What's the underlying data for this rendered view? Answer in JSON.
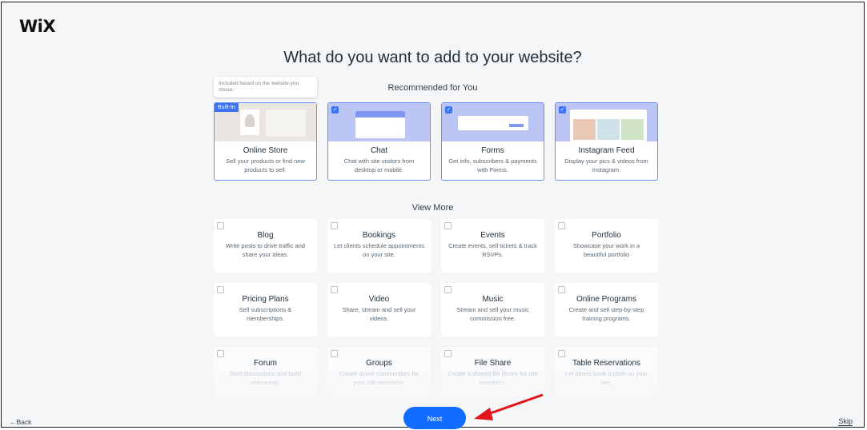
{
  "app": {
    "logo": "WiX"
  },
  "page": {
    "title": "What do you want to add to your website?"
  },
  "tooltip": {
    "text": "Included based on the website you chose."
  },
  "recommended": {
    "label": "Recommended for You",
    "cards": [
      {
        "badge": "Built-In",
        "name": "Online Store",
        "desc": "Sell your products or find new products to sell.",
        "checked": true
      },
      {
        "name": "Chat",
        "desc": "Chat with site visitors from desktop or mobile.",
        "checked": true
      },
      {
        "name": "Forms",
        "desc": "Get info, subscribers & payments with Forms.",
        "checked": true
      },
      {
        "name": "Instagram Feed",
        "desc": "Display your pics & videos from Instagram.",
        "checked": true
      }
    ]
  },
  "more": {
    "label": "View More",
    "cards": [
      {
        "name": "Blog",
        "desc": "Write posts to drive traffic and share your ideas."
      },
      {
        "name": "Bookings",
        "desc": "Let clients schedule appointments on your site."
      },
      {
        "name": "Events",
        "desc": "Create events, sell tickets & track RSVPs."
      },
      {
        "name": "Portfolio",
        "desc": "Showcase your work in a beautiful portfolio"
      },
      {
        "name": "Pricing Plans",
        "desc": "Sell subscriptions & memberships."
      },
      {
        "name": "Video",
        "desc": "Share, stream and sell your videos."
      },
      {
        "name": "Music",
        "desc": "Stream and sell your music commission free."
      },
      {
        "name": "Online Programs",
        "desc": "Create and sell step-by-step training programs."
      },
      {
        "name": "Forum",
        "desc": "Start discussions and build community."
      },
      {
        "name": "Groups",
        "desc": "Create active communities for your site members."
      },
      {
        "name": "File Share",
        "desc": "Create a shared file library for site members."
      },
      {
        "name": "Table Reservations",
        "desc": "Let diners book a table on your site."
      }
    ]
  },
  "footer": {
    "back": "←Back",
    "next": "Next",
    "skip": "Skip"
  },
  "colors": {
    "accent": "#116dff",
    "selected_border": "#6b8ef2",
    "thumb": "#bcc6f5",
    "annotation_arrow": "#e0141a"
  }
}
